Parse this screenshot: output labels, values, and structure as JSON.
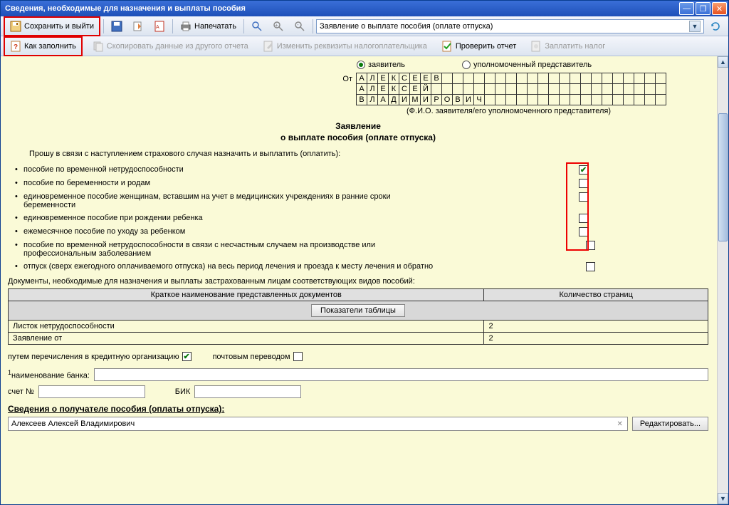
{
  "window": {
    "title": "Сведения, необходимые для назначения и выплаты пособия"
  },
  "toolbar": {
    "save_exit": "Сохранить и выйти",
    "print": "Напечатать",
    "how_fill": "Как заполнить",
    "copy_other": "Скопировать данные из другого отчета",
    "change_req": "Изменить реквизиты налогоплательщика",
    "check_report": "Проверить отчет",
    "pay_tax": "Заплатить налог",
    "dropdown": "Заявление о выплате пособия (оплате отпуска)"
  },
  "form": {
    "from_label": "От",
    "applicant": "заявитель",
    "representative": "уполномоченный представитель",
    "name_rows": [
      [
        "А",
        "Л",
        "Е",
        "К",
        "С",
        "Е",
        "Е",
        "В",
        "",
        "",
        "",
        "",
        "",
        "",
        "",
        "",
        "",
        "",
        "",
        "",
        "",
        "",
        "",
        "",
        "",
        "",
        "",
        "",
        ""
      ],
      [
        "А",
        "Л",
        "Е",
        "К",
        "С",
        "Е",
        "Й",
        "",
        "",
        "",
        "",
        "",
        "",
        "",
        "",
        "",
        "",
        "",
        "",
        "",
        "",
        "",
        "",
        "",
        "",
        "",
        "",
        "",
        ""
      ],
      [
        "В",
        "Л",
        "А",
        "Д",
        "И",
        "М",
        "И",
        "Р",
        "О",
        "В",
        "И",
        "Ч",
        "",
        "",
        "",
        "",
        "",
        "",
        "",
        "",
        "",
        "",
        "",
        "",
        "",
        "",
        "",
        "",
        ""
      ]
    ],
    "fio_caption": "(Ф.И.О. заявителя/его уполномоченного представителя)",
    "title1": "Заявление",
    "title2": "о выплате пособия (оплате отпуска)",
    "intro": "Прошу в связи с наступлением страхового случая назначить и выплатить (оплатить):",
    "benefits": [
      {
        "text": "пособие по временной нетрудоспособности",
        "checked": true
      },
      {
        "text": "пособие по беременности и родам",
        "checked": false
      },
      {
        "text": "единовременное пособие женщинам, вставшим на учет в медицинских учреждениях в ранние сроки беременности",
        "checked": false
      },
      {
        "text": "единовременное пособие при рождении ребенка",
        "checked": false
      },
      {
        "text": "ежемесячное пособие по уходу за ребенком",
        "checked": false
      },
      {
        "text": "пособие по временной нетрудоспособности в связи с несчастным случаем на производстве или профессиональным заболеванием",
        "checked": false
      },
      {
        "text": "отпуск (сверх ежегодного оплачиваемого отпуска) на весь период лечения и проезда к месту лечения и обратно",
        "checked": false
      }
    ],
    "docs_intro": "Документы, необходимые для назначения и выплаты застрахованным лицам соответствующих видов пособий:",
    "doc_headers": {
      "name": "Краткое наименование представленных документов",
      "pages": "Количество страниц"
    },
    "show_table": "Показатели таблицы",
    "doc_rows": [
      {
        "name": "Листок нетрудоспособности",
        "pages": "2"
      },
      {
        "name": "Заявление от",
        "pages": "2"
      }
    ],
    "pay_credit": "путем перечисления в кредитную организацию",
    "pay_post": "почтовым переводом",
    "bank_name_label": "наименование банка:",
    "account_label": "счет №",
    "bik_label": "БИК",
    "recipient_header": "Сведения о получателе пособия (оплаты отпуска):",
    "recipient_value": "Алексеев Алексей Владимирович",
    "edit_btn": "Редактировать..."
  }
}
